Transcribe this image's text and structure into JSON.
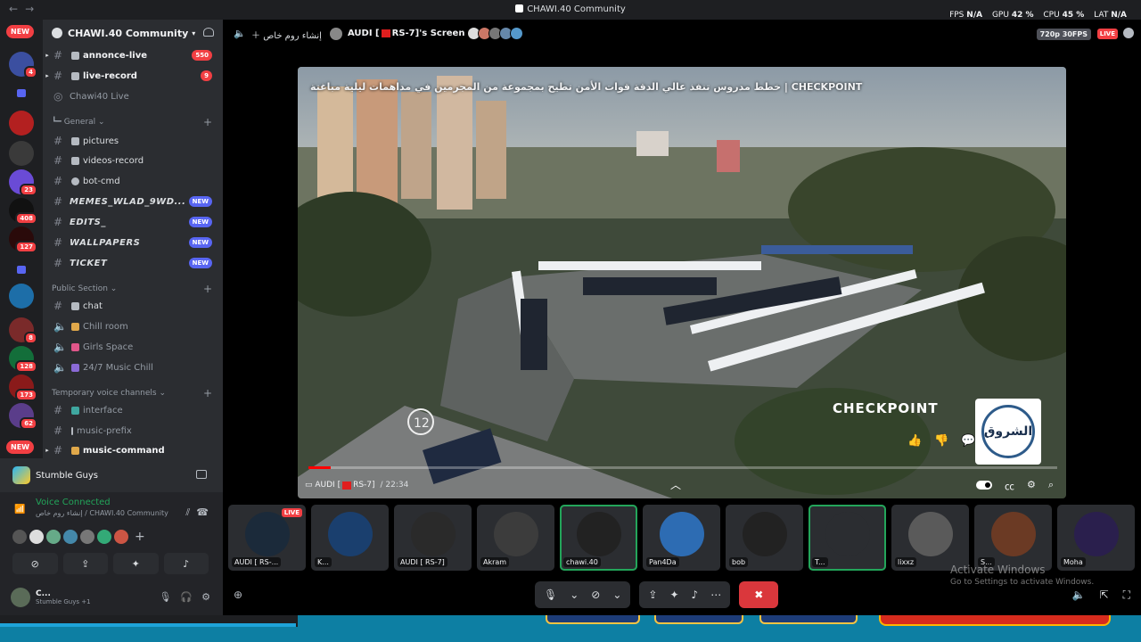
{
  "window": {
    "title": "CHAWI.40 Community",
    "perf": [
      {
        "label": "FPS",
        "value": "N/A"
      },
      {
        "label": "GPU",
        "value": "42 %"
      },
      {
        "label": "CPU",
        "value": "45 %"
      },
      {
        "label": "LAT",
        "value": "N/A"
      }
    ]
  },
  "rail": {
    "new_top": "NEW",
    "new_bottom": "NEW",
    "badges": [
      "4",
      "23",
      "408",
      "127",
      "8",
      "128",
      "173",
      "62"
    ]
  },
  "sidebar": {
    "guild_name": "CHAWI.40 Community",
    "channels_top": [
      {
        "label": "annonce-live",
        "count": "550"
      },
      {
        "label": "live-record",
        "count": "9"
      },
      {
        "label": "Chawi40 Live"
      }
    ],
    "category_general": "General",
    "general_channels": [
      {
        "label": "pictures"
      },
      {
        "label": "videos-record"
      },
      {
        "label": "bot-cmd"
      },
      {
        "label": "MEMES_WLAD_9WD...",
        "tag": "NEW"
      },
      {
        "label": "EDITS_",
        "tag": "NEW"
      },
      {
        "label": "WALLPAPERS",
        "tag": "NEW"
      },
      {
        "label": "TICKET",
        "tag": "NEW"
      }
    ],
    "category_public": "Public Section",
    "public_channels": [
      {
        "label": "chat"
      },
      {
        "label": "Chill room"
      },
      {
        "label": "Girls Space"
      },
      {
        "label": "24/7 Music Chill"
      }
    ],
    "category_temp": "Temporary voice channels",
    "temp_channels": [
      {
        "label": "interface"
      },
      {
        "label": "music-prefix"
      },
      {
        "label": "music-command"
      }
    ]
  },
  "voice_panel": {
    "activity": "Stumble Guys",
    "status": "Voice Connected",
    "location": "إنشاء روم خاص / CHAWI.40 Community",
    "user_name": "C...",
    "user_status": "Stumble Guys +1"
  },
  "stage": {
    "create_room": "إنشاء روم خاص",
    "streamer_prefix": "AUDI [",
    "streamer_suffix": "RS-7]'s Screen",
    "quality": "720p 30FPS",
    "live": "LIVE",
    "video_caption": "خطط مدروس تنفذ عالي الدقة قوات الأمن تطيح بمجموعة من المجرمين في مداهمات ليلية مباغتة | CHECKPOINT",
    "brand": "CHECKPOINT",
    "logo_text": "الشروق",
    "stream_tag_prefix": "AUDI [",
    "stream_tag_suffix": "RS-7]",
    "stream_time": "/ 22:34",
    "video_progress": 0.03
  },
  "tiles": [
    {
      "name": "AUDI [ RS-...",
      "live": "LIVE",
      "color": "#1b2a3a"
    },
    {
      "name": "K...",
      "color": "#1a3f6e"
    },
    {
      "name": "AUDI [ RS-7]",
      "color": "#2a2a2a"
    },
    {
      "name": "Akram",
      "color": "#3c3c3c"
    },
    {
      "name": "chawi.40",
      "color": "#222",
      "speaking": true
    },
    {
      "name": "Pan4Da",
      "color": "#2d6cb3"
    },
    {
      "name": "bob",
      "color": "#222"
    },
    {
      "name": "T...",
      "color": "#2b2d31",
      "speaking": true
    },
    {
      "name": "lixxz",
      "color": "#5a5a5a"
    },
    {
      "name": "S...",
      "color": "#6b3a24"
    },
    {
      "name": "Moha",
      "color": "#2a1f4d"
    }
  ],
  "watermark": {
    "title": "Activate Windows",
    "subtitle": "Go to Settings to activate Windows."
  }
}
